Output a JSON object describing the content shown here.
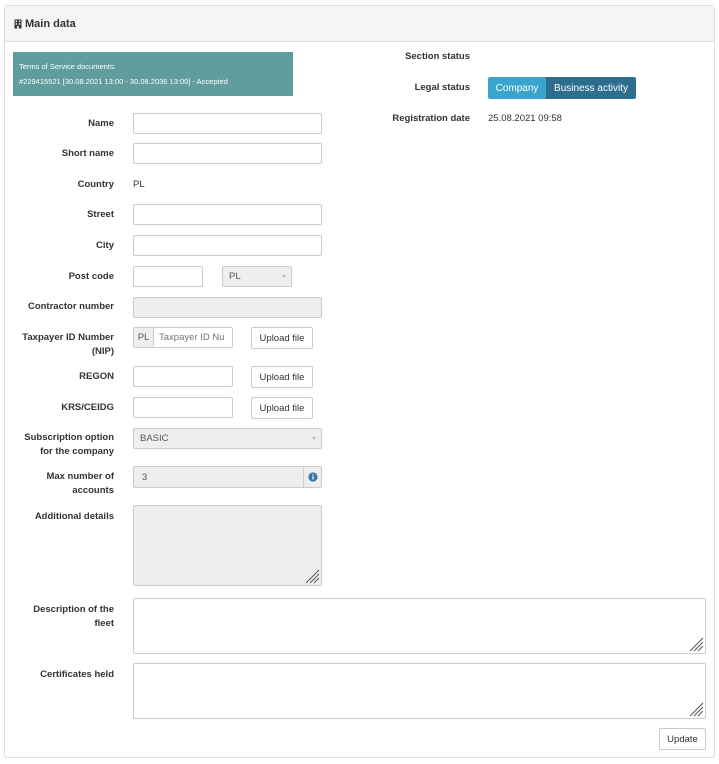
{
  "panel": {
    "title": "Main data"
  },
  "tos": {
    "title": "Terms of Service documents:",
    "line": "#229415521 [30.08.2021 13:00 - 30.08.2036 13:00] - Accepted"
  },
  "right": {
    "section_status_label": "Section status",
    "legal_status_label": "Legal status",
    "legal_status_options": [
      "Company",
      "Business activity"
    ],
    "legal_status_selected": "Company",
    "registration_date_label": "Registration date",
    "registration_date_value": "25.08.2021 09:58"
  },
  "form": {
    "name_label": "Name",
    "name_value": "",
    "short_name_label": "Short name",
    "short_name_value": "",
    "country_label": "Country",
    "country_value": "PL",
    "street_label": "Street",
    "street_value": "",
    "city_label": "City",
    "city_value": "",
    "post_code_label": "Post code",
    "post_code_value": "",
    "post_code_country": "PL",
    "contractor_label": "Contractor number",
    "contractor_value": "",
    "nip_label_1": "Taxpayer ID Number",
    "nip_label_2": "(NIP)",
    "nip_prefix": "PL",
    "nip_placeholder": "Taxpayer ID Nu",
    "upload_label": "Upload file",
    "regon_label": "REGON",
    "regon_value": "",
    "krs_label": "KRS/CEIDG",
    "krs_value": "",
    "subscription_label_1": "Subscription option",
    "subscription_label_2": "for the company",
    "subscription_value": "BASIC",
    "max_accounts_label_1": "Max number of",
    "max_accounts_label_2": "accounts",
    "max_accounts_value": "3",
    "additional_label": "Additional details",
    "fleet_label_1": "Description of the",
    "fleet_label_2": "fleet",
    "certificates_label": "Certificates held",
    "update_label": "Update"
  },
  "colors": {
    "tos_bg": "#5f9e9c",
    "segment_active": "#3aa4cf",
    "segment_inactive": "#2d6e8e",
    "info_icon": "#3c76a6"
  }
}
